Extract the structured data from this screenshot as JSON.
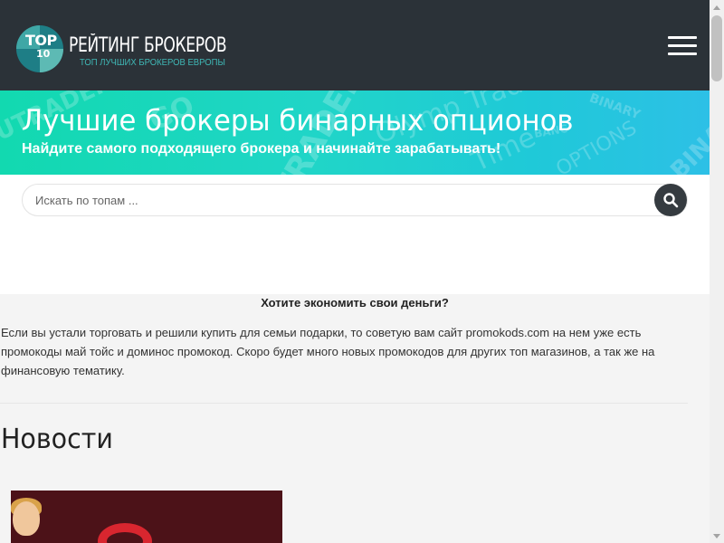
{
  "header": {
    "logo": {
      "badge_top": "TOP",
      "badge_number": "10",
      "title": "РЕЙТИНГ БРОКЕРОВ",
      "subtitle": "ТОП ЛУЧШИХ БРОКЕРОВ ЕВРОПЫ"
    },
    "menu_icon": "hamburger-menu-icon"
  },
  "banner": {
    "title": "Лучшие брокеры бинарных опционов",
    "subtitle": "Найдите самого подходящего брокера и начинайте зарабатывать!",
    "watermarks": [
      "UTRADER",
      "GO",
      "UTRADER",
      "Olymp Trade",
      "Time",
      "BINARY",
      "OPTIONS",
      "BANC",
      "BINARY"
    ]
  },
  "search": {
    "placeholder": "Искать по топам ...",
    "value": "",
    "button_icon": "search-icon"
  },
  "promo": {
    "title": "Хотите экономить свои деньги?",
    "text": "Если вы устали торговать и решили купить для семьи подарки, то советую вам сайт promokods.com на нем уже есть промокоды май тойс и доминос промокод. Скоро будет много новых промокодов для других топ магазинов, а так же на финансовую тематику."
  },
  "news": {
    "title": "Новости"
  },
  "colors": {
    "header_bg": "#2b3238",
    "banner_gradient_start": "#12d9b0",
    "banner_gradient_end": "#2dc0e6",
    "accent_teal": "#3fb8b6",
    "search_button": "#353b40",
    "page_bg": "#f4f4f4"
  }
}
